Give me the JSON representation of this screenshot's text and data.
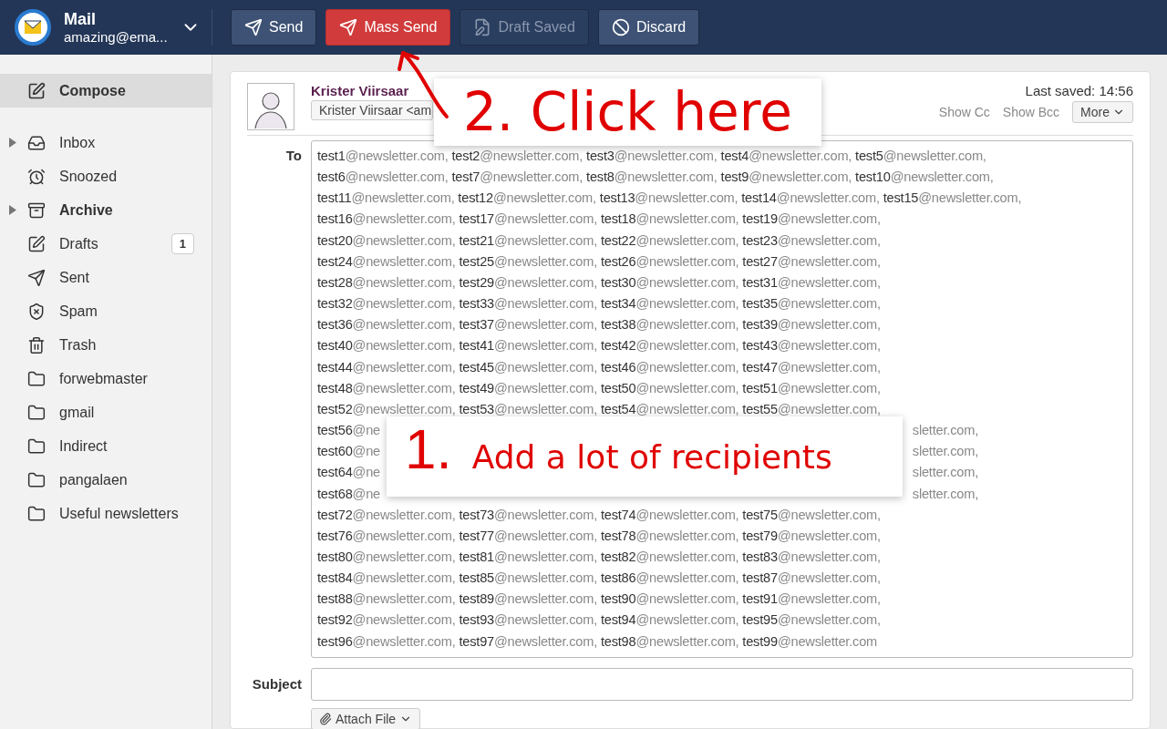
{
  "app": {
    "title": "Mail",
    "account": "amazing@ema..."
  },
  "toolbar": [
    {
      "label": "Send",
      "kind": "send",
      "disabled": false
    },
    {
      "label": "Mass Send",
      "kind": "mass_send",
      "disabled": false
    },
    {
      "label": "Draft Saved",
      "kind": "draft",
      "disabled": true
    },
    {
      "label": "Discard",
      "kind": "discard",
      "disabled": false
    }
  ],
  "sidebar": {
    "compose": {
      "label": "Compose",
      "selected": true
    },
    "folders": [
      {
        "label": "Inbox",
        "kind": "inbox",
        "expandable": true,
        "unread": false
      },
      {
        "label": "Snoozed",
        "kind": "snoozed",
        "expandable": false,
        "unread": false
      },
      {
        "label": "Archive",
        "kind": "archive",
        "expandable": true,
        "unread": true
      },
      {
        "label": "Drafts",
        "kind": "drafts",
        "expandable": false,
        "unread": false,
        "badge": "1"
      },
      {
        "label": "Sent",
        "kind": "sent",
        "expandable": false,
        "unread": false
      },
      {
        "label": "Spam",
        "kind": "spam",
        "expandable": false,
        "unread": false
      },
      {
        "label": "Trash",
        "kind": "trash",
        "expandable": false,
        "unread": false
      },
      {
        "label": "forwebmaster",
        "kind": "folder",
        "expandable": false,
        "unread": false
      },
      {
        "label": "gmail",
        "kind": "folder",
        "expandable": false,
        "unread": false
      },
      {
        "label": "Indirect",
        "kind": "folder",
        "expandable": false,
        "unread": false
      },
      {
        "label": "pangalaen",
        "kind": "folder",
        "expandable": false,
        "unread": false
      },
      {
        "label": "Useful newsletters",
        "kind": "folder",
        "expandable": false,
        "unread": false
      }
    ]
  },
  "compose": {
    "sender_name": "Krister Viirsaar",
    "sender_field": "Krister Viirsaar <am",
    "last_saved": "Last saved: 14:56",
    "links": [
      "Show Cc",
      "Show Bcc"
    ],
    "more": "More",
    "to_label": "To",
    "recipient_lines": [
      {
        "kind": "full",
        "text": "test1@newsletter.com, test2@newsletter.com, test3@newsletter.com, test4@newsletter.com, test5@newsletter.com,"
      },
      {
        "kind": "full",
        "text": "test6@newsletter.com, test7@newsletter.com, test8@newsletter.com, test9@newsletter.com, test10@newsletter.com,"
      },
      {
        "kind": "full",
        "text": "test11@newsletter.com, test12@newsletter.com, test13@newsletter.com, test14@newsletter.com, test15@newsletter.com,"
      },
      {
        "kind": "full",
        "text": "test16@newsletter.com, test17@newsletter.com, test18@newsletter.com, test19@newsletter.com,"
      },
      {
        "kind": "full",
        "text": "test20@newsletter.com, test21@newsletter.com, test22@newsletter.com, test23@newsletter.com,"
      },
      {
        "kind": "full",
        "text": "test24@newsletter.com, test25@newsletter.com, test26@newsletter.com, test27@newsletter.com,"
      },
      {
        "kind": "full",
        "text": "test28@newsletter.com, test29@newsletter.com, test30@newsletter.com, test31@newsletter.com,"
      },
      {
        "kind": "full",
        "text": "test32@newsletter.com, test33@newsletter.com, test34@newsletter.com, test35@newsletter.com,"
      },
      {
        "kind": "full",
        "text": "test36@newsletter.com, test37@newsletter.com, test38@newsletter.com, test39@newsletter.com,"
      },
      {
        "kind": "full",
        "text": "test40@newsletter.com, test41@newsletter.com, test42@newsletter.com, test43@newsletter.com,"
      },
      {
        "kind": "full",
        "text": "test44@newsletter.com, test45@newsletter.com, test46@newsletter.com, test47@newsletter.com,"
      },
      {
        "kind": "full",
        "text": "test48@newsletter.com, test49@newsletter.com, test50@newsletter.com, test51@newsletter.com,"
      },
      {
        "kind": "full",
        "text": "test52@newsletter.com, test53@newsletter.com, test54@newsletter.com, test55@newsletter.com,"
      },
      {
        "kind": "covered",
        "text": "test56@ne",
        "after": "sletter.com,"
      },
      {
        "kind": "covered",
        "text": "test60@ne",
        "after": "sletter.com,"
      },
      {
        "kind": "covered",
        "text": "test64@ne",
        "after": "sletter.com,"
      },
      {
        "kind": "covered",
        "text": "test68@ne",
        "after": "sletter.com,"
      },
      {
        "kind": "full",
        "text": "test72@newsletter.com, test73@newsletter.com, test74@newsletter.com, test75@newsletter.com,"
      },
      {
        "kind": "full",
        "text": "test76@newsletter.com, test77@newsletter.com, test78@newsletter.com, test79@newsletter.com,"
      },
      {
        "kind": "full",
        "text": "test80@newsletter.com, test81@newsletter.com, test82@newsletter.com, test83@newsletter.com,"
      },
      {
        "kind": "full",
        "text": "test84@newsletter.com, test85@newsletter.com, test86@newsletter.com, test87@newsletter.com,"
      },
      {
        "kind": "full",
        "text": "test88@newsletter.com, test89@newsletter.com, test90@newsletter.com, test91@newsletter.com,"
      },
      {
        "kind": "full",
        "text": "test92@newsletter.com, test93@newsletter.com, test94@newsletter.com, test95@newsletter.com,"
      },
      {
        "kind": "full",
        "text": "test96@newsletter.com, test97@newsletter.com, test98@newsletter.com, test99@newsletter.com"
      }
    ],
    "subject_label": "Subject",
    "attach": "Attach File"
  },
  "annotations": [
    {
      "text": "2. Click here"
    },
    {
      "number": "1.",
      "text": "Add a lot of recipients"
    }
  ]
}
